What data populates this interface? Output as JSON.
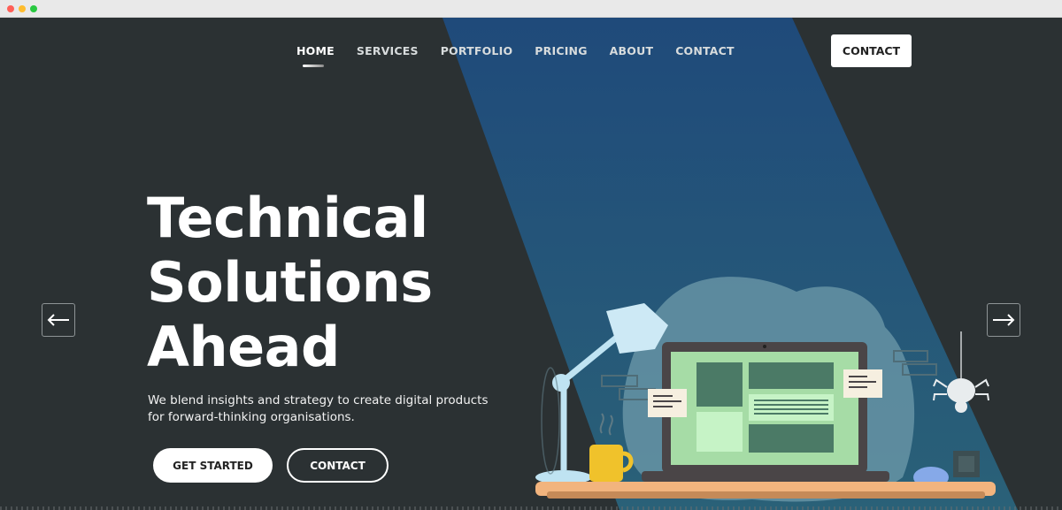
{
  "nav": {
    "items": [
      {
        "label": "HOME",
        "active": true
      },
      {
        "label": "SERVICES",
        "active": false
      },
      {
        "label": "PORTFOLIO",
        "active": false
      },
      {
        "label": "PRICING",
        "active": false
      },
      {
        "label": "ABOUT",
        "active": false
      },
      {
        "label": "CONTACT",
        "active": false
      }
    ],
    "cta_label": "CONTACT"
  },
  "hero": {
    "title_lines": [
      "Technical",
      "Solutions",
      "Ahead"
    ],
    "subtitle": "We blend insights and strategy to create digital products for forward-thinking organisations.",
    "primary_button": "GET STARTED",
    "secondary_button": "CONTACT"
  },
  "carousel": {
    "prev_icon": "arrow-left-icon",
    "next_icon": "arrow-right-icon"
  },
  "colors": {
    "background": "#2b3133",
    "beam_top": "#1f4a7a",
    "beam_bottom": "#2b5c74",
    "accent_white": "#ffffff"
  }
}
